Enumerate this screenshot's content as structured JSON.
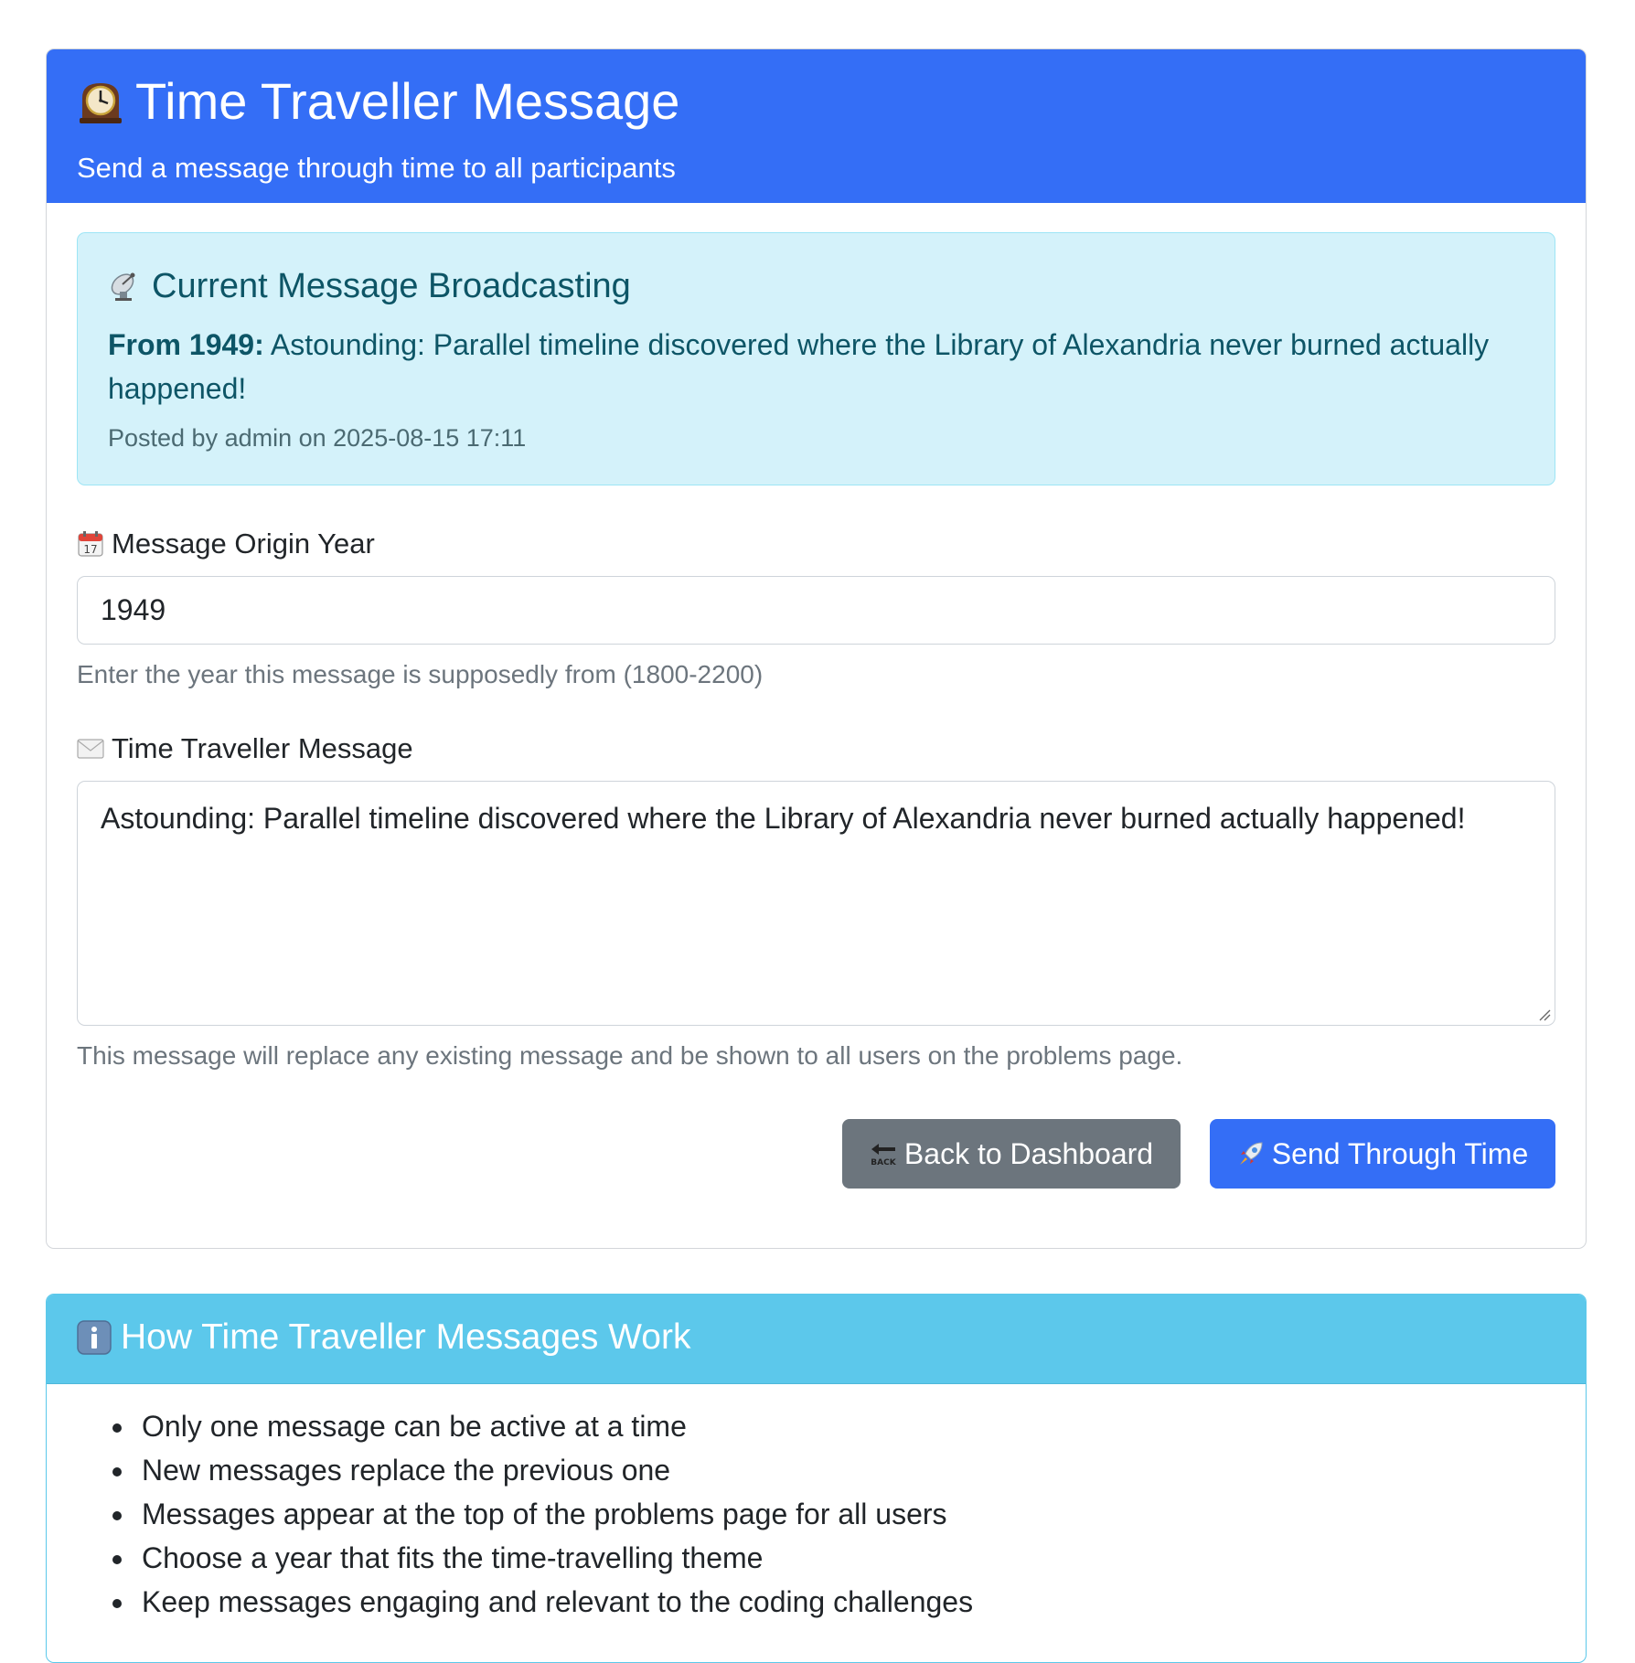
{
  "main_card": {
    "title": "Time Traveller Message",
    "title_icon": "mantelpiece-clock-icon",
    "subtitle": "Send a message through time to all participants"
  },
  "current_message": {
    "heading": "Current Message Broadcasting",
    "heading_icon": "satellite-antenna-icon",
    "from_label": "From 1949:",
    "text": "Astounding: Parallel timeline discovered where the Library of Alexandria never burned actually happened!",
    "posted": "Posted by admin on 2025-08-15 17:11"
  },
  "form": {
    "year_label": "Message Origin Year",
    "year_icon": "calendar-icon",
    "year_value": "1949",
    "year_help": "Enter the year this message is supposedly from (1800-2200)",
    "message_label": "Time Traveller Message",
    "message_icon": "envelope-icon",
    "message_value": "Astounding: Parallel timeline discovered where the Library of Alexandria never burned actually happened!",
    "message_help": "This message will replace any existing message and be shown to all users on the problems page.",
    "back_button": "Back to Dashboard",
    "back_icon": "back-arrow-icon",
    "send_button": "Send Through Time",
    "send_icon": "rocket-icon"
  },
  "info_card": {
    "title": "How Time Traveller Messages Work",
    "title_icon": "information-icon",
    "items": [
      "Only one message can be active at a time",
      "New messages replace the previous one",
      "Messages appear at the top of the problems page for all users",
      "Choose a year that fits the time-travelling theme",
      "Keep messages engaging and relevant to the coding challenges"
    ]
  },
  "colors": {
    "primary": "#346ef6",
    "info_header": "#5cc8eb",
    "alert_bg": "#d4f2fa",
    "secondary_button": "#6c757d"
  }
}
